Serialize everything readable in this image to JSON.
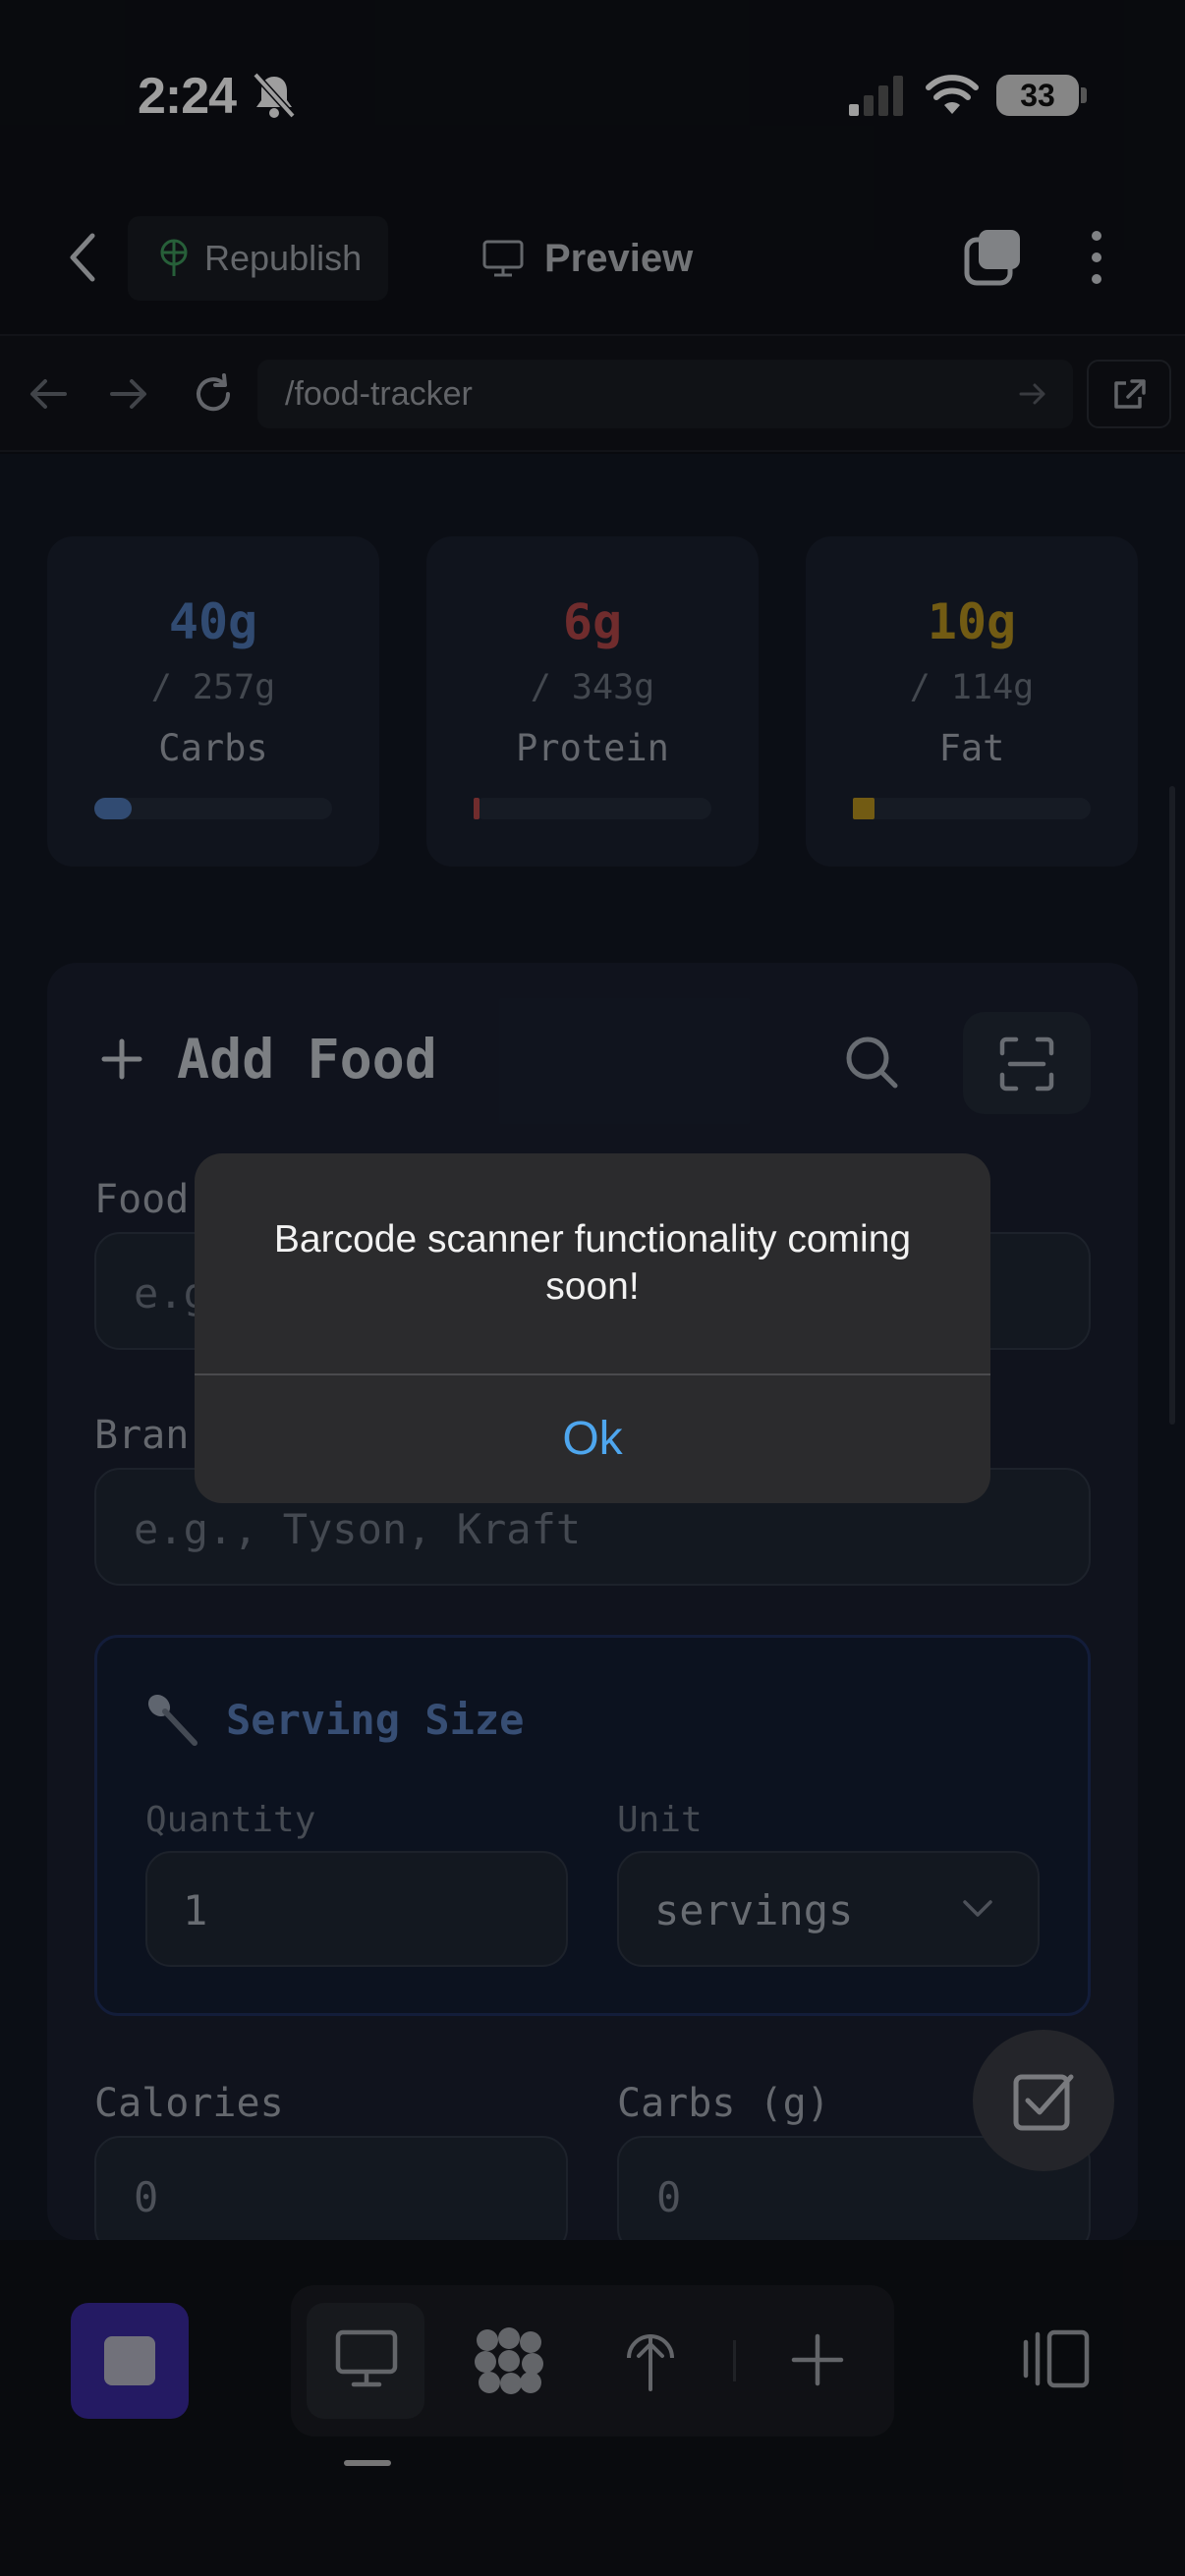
{
  "status_bar": {
    "time": "2:24",
    "battery": "33"
  },
  "header": {
    "republish_label": "Republish",
    "preview_label": "Preview"
  },
  "browser": {
    "url": "/food-tracker"
  },
  "macros": [
    {
      "value": "40g",
      "goal": "/ 257g",
      "label": "Carbs",
      "color": "#4f79b8",
      "progress": 0.156
    },
    {
      "value": "6g",
      "goal": "/ 343g",
      "label": "Protein",
      "color": "#b5484a",
      "progress": 0.017
    },
    {
      "value": "10g",
      "goal": "/ 114g",
      "label": "Fat",
      "color": "#b89420",
      "progress": 0.088
    }
  ],
  "form": {
    "title": "Add Food",
    "food_label": "Food",
    "food_placeholder": "e.g",
    "brand_label": "Bran",
    "brand_placeholder": "e.g., Tyson, Kraft",
    "serving": {
      "title": "Serving Size",
      "quantity_label": "Quantity",
      "quantity_value": "1",
      "unit_label": "Unit",
      "unit_value": "servings"
    },
    "calories_label": "Calories",
    "calories_value": "0",
    "carbs_label": "Carbs (g)",
    "carbs_value": "0"
  },
  "alert": {
    "message": "Barcode scanner functionality coming soon!",
    "ok_label": "Ok"
  },
  "icons": {
    "back": "chevron-left-icon",
    "republish": "globe-tree-icon",
    "preview": "monitor-icon",
    "tabs": "tabs-icon",
    "more": "more-vertical-icon",
    "scan": "barcode-scan-icon",
    "search": "search-icon",
    "spoon": "spoon-icon",
    "fab": "checkbox-icon"
  },
  "colors": {
    "accent": "#3b2aa0",
    "alert_button": "#4ea6ee"
  }
}
